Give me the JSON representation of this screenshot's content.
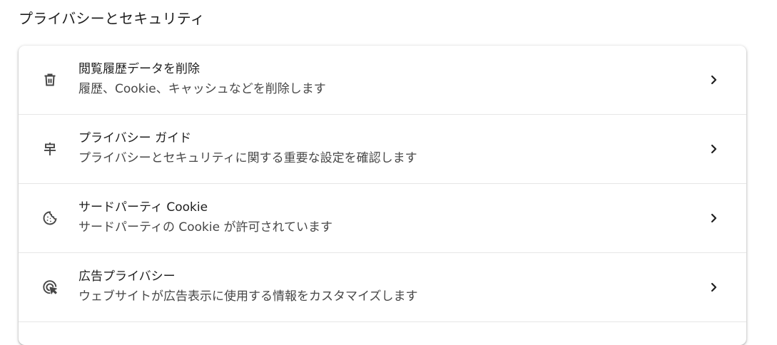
{
  "section": {
    "title": "プライバシーとセキュリティ"
  },
  "items": [
    {
      "icon": "trash-icon",
      "label": "閲覧履歴データを削除",
      "sublabel": "履歴、Cookie、キャッシュなどを削除します"
    },
    {
      "icon": "signpost-icon",
      "label": "プライバシー ガイド",
      "sublabel": "プライバシーとセキュリティに関する重要な設定を確認します"
    },
    {
      "icon": "cookie-icon",
      "label": "サードパーティ Cookie",
      "sublabel": "サードパーティの Cookie が許可されています"
    },
    {
      "icon": "ad-privacy-icon",
      "label": "広告プライバシー",
      "sublabel": "ウェブサイトが広告表示に使用する情報をカスタマイズします"
    }
  ],
  "colors": {
    "text_primary": "#1f1f1f",
    "text_secondary": "#474747",
    "divider": "#e6e6e6",
    "icon": "#474747"
  }
}
